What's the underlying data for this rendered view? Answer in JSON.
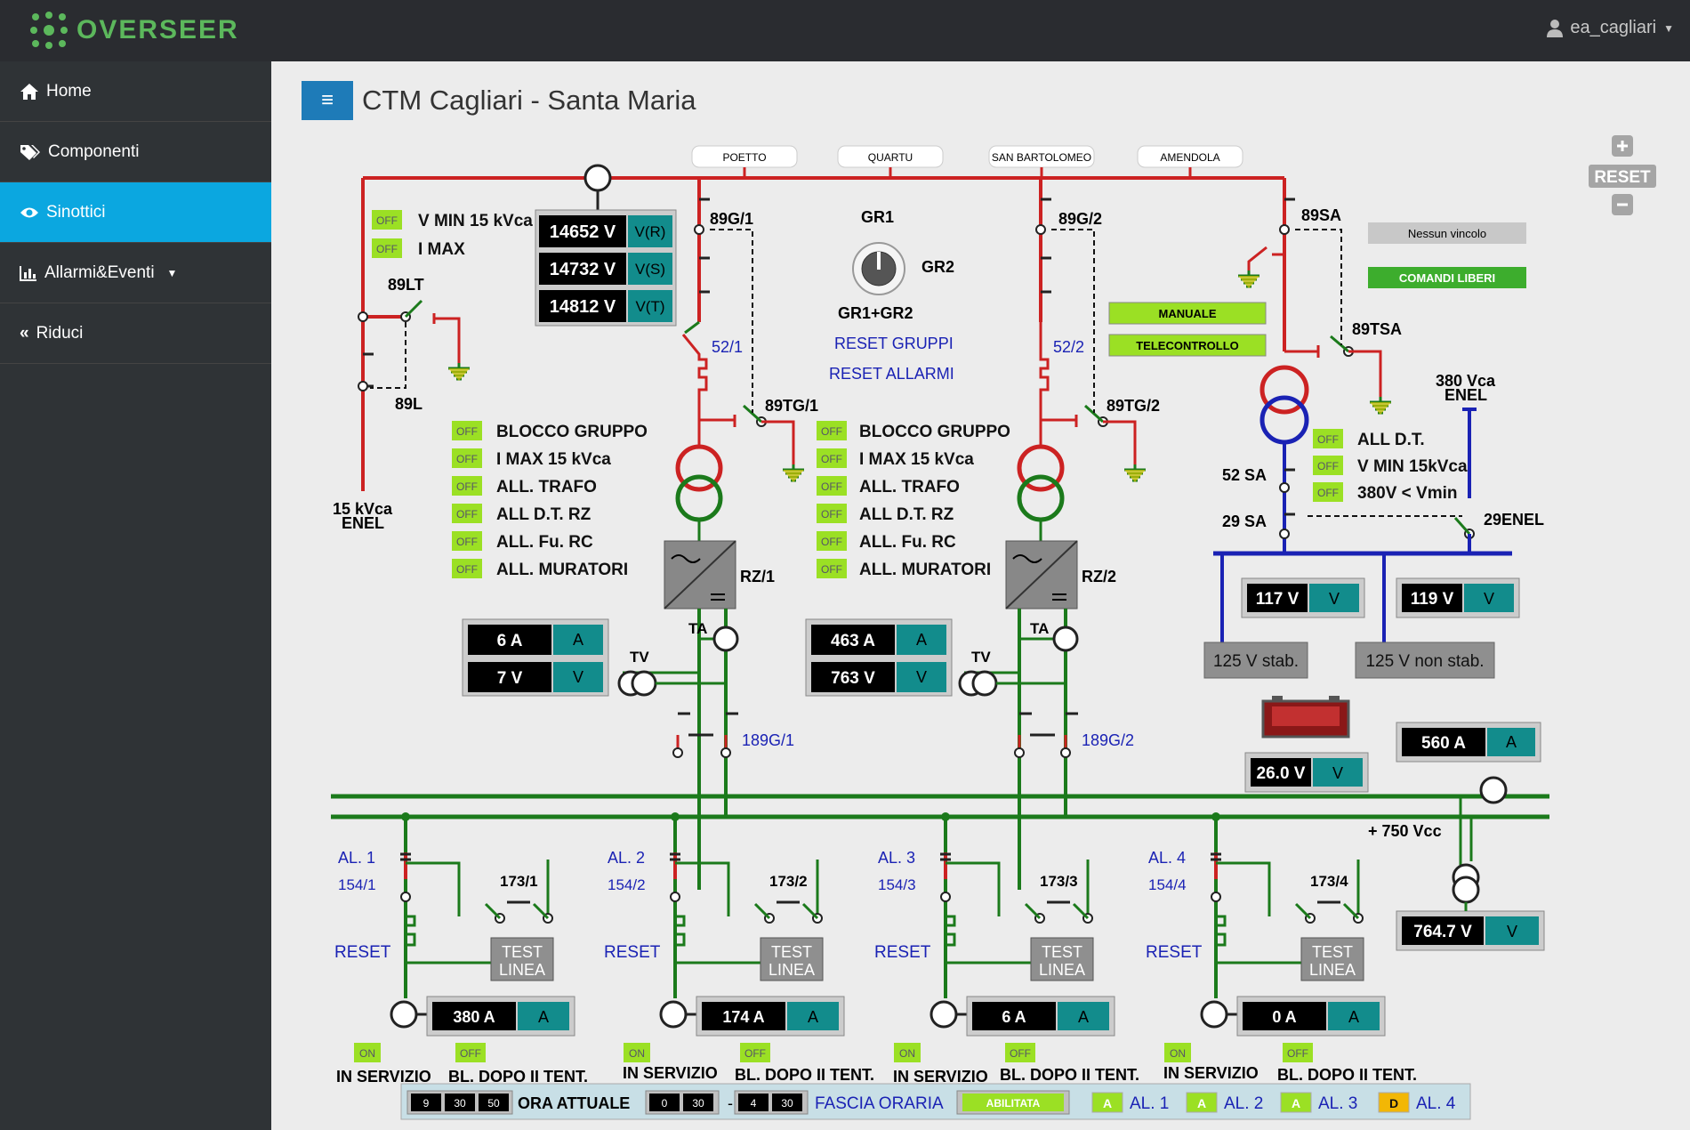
{
  "app": {
    "name": "OVERSEER",
    "user": "ea_cagliari"
  },
  "sidebar": {
    "items": [
      {
        "label": "Home",
        "icon": "home-icon"
      },
      {
        "label": "Componenti",
        "icon": "tags-icon"
      },
      {
        "label": "Sinottici",
        "icon": "eye-icon",
        "active": true
      },
      {
        "label": "Allarmi&Eventi",
        "icon": "bar-chart-icon"
      },
      {
        "label": "Riduci",
        "icon": "double-chevron-left-icon"
      }
    ]
  },
  "page": {
    "title": "CTM Cagliari - Santa Maria"
  },
  "zoom": {
    "plus": "+",
    "reset": "RESET",
    "minus": "−"
  },
  "feeders": [
    "POETTO",
    "QUARTU",
    "SAN BARTOLOMEO",
    "AMENDOLA"
  ],
  "labels": {
    "v_min_15": "V MIN 15 kVca",
    "i_max": "I MAX",
    "lt89": "89LT",
    "l89": "89L",
    "enel15a": "15 kVca",
    "enel15b": "ENEL",
    "g1": "89G/1",
    "g2": "89G/2",
    "sa89": "89SA",
    "tsa89": "89TSA",
    "s521": "52/1",
    "s522": "52/2",
    "tg1": "89TG/1",
    "tg2": "89TG/2",
    "gr1": "GR1",
    "gr2": "GR2",
    "gr12": "GR1+GR2",
    "reset_gruppi": "RESET GRUPPI",
    "reset_allarmi": "RESET ALLARMI",
    "nessun_vincolo": "Nessun vincolo",
    "comandi_liberi": "COMANDI LIBERI",
    "manuale": "MANUALE",
    "telecontrollo": "TELECONTROLLO",
    "enel380a": "380 Vca",
    "enel380b": "ENEL",
    "sa52": "52 SA",
    "sa29": "29 SA",
    "enel29": "29ENEL",
    "rz1": "RZ/1",
    "rz2": "RZ/2",
    "ta": "TA",
    "tv": "TV",
    "g1891": "189G/1",
    "g1892": "189G/2",
    "stab": "125 V stab.",
    "nonstab": "125 V non stab.",
    "vcc750": "+ 750 Vcc",
    "off": "OFF",
    "on": "ON"
  },
  "voltages_main": [
    {
      "value": "14652 V",
      "unit": "V(R)"
    },
    {
      "value": "14732 V",
      "unit": "V(S)"
    },
    {
      "value": "14812 V",
      "unit": "V(T)"
    }
  ],
  "alarms_group": [
    "BLOCCO GRUPPO",
    "I MAX 15 kVca",
    "ALL. TRAFO",
    "ALL D.T. RZ",
    "ALL. Fu. RC",
    "ALL. MURATORI"
  ],
  "alarms_sa": [
    "ALL D.T.",
    "V MIN 15kVca",
    "380V < Vmin"
  ],
  "group1_meters": [
    {
      "value": "6 A",
      "unit": "A"
    },
    {
      "value": "7 V",
      "unit": "V"
    }
  ],
  "group2_meters": [
    {
      "value": "463 A",
      "unit": "A"
    },
    {
      "value": "763 V",
      "unit": "V"
    }
  ],
  "aux_meters": {
    "v117": {
      "value": "117 V",
      "unit": "V"
    },
    "v119": {
      "value": "119 V",
      "unit": "V"
    },
    "v26": {
      "value": "26.0 V",
      "unit": "V"
    },
    "a560": {
      "value": "560 A",
      "unit": "A"
    },
    "v764": {
      "value": "764.7 V",
      "unit": "V"
    }
  },
  "lines": [
    {
      "al": "AL. 1",
      "code": "154/1",
      "disc": "173/1",
      "reset": "RESET",
      "test1": "TEST",
      "test2": "LINEA",
      "current": "380 A",
      "unit": "A",
      "in_servizio": "IN SERVIZIO",
      "bl": "BL. DOPO II TENT."
    },
    {
      "al": "AL. 2",
      "code": "154/2",
      "disc": "173/2",
      "reset": "RESET",
      "test1": "TEST",
      "test2": "LINEA",
      "current": "174 A",
      "unit": "A",
      "in_servizio": "IN SERVIZIO",
      "bl": "BL. DOPO II TENT."
    },
    {
      "al": "AL. 3",
      "code": "154/3",
      "disc": "173/3",
      "reset": "RESET",
      "test1": "TEST",
      "test2": "LINEA",
      "current": "6 A",
      "unit": "A",
      "in_servizio": "IN SERVIZIO",
      "bl": "BL. DOPO II TENT."
    },
    {
      "al": "AL. 4",
      "code": "154/4",
      "disc": "173/4",
      "reset": "RESET",
      "test1": "TEST",
      "test2": "LINEA",
      "current": "0 A",
      "unit": "A",
      "in_servizio": "IN SERVIZIO",
      "bl": "BL. DOPO II TENT."
    }
  ],
  "bottom": {
    "time": [
      "9",
      "30",
      "50"
    ],
    "ora_attuale": "ORA ATTUALE",
    "fascia_from": [
      "0",
      "30"
    ],
    "dash": "-",
    "fascia_to": [
      "4",
      "30"
    ],
    "fascia_oraria": "FASCIA ORARIA",
    "abilitata": "ABILITATA",
    "al_badges": [
      {
        "badge": "A",
        "label": "AL. 1",
        "color": "#9be024"
      },
      {
        "badge": "A",
        "label": "AL. 2",
        "color": "#9be024"
      },
      {
        "badge": "A",
        "label": "AL. 3",
        "color": "#9be024"
      },
      {
        "badge": "D",
        "label": "AL. 4",
        "color": "#f2b705"
      }
    ]
  },
  "colors": {
    "green_line": "#1b7a1b",
    "red_line": "#cc2222",
    "blue_line": "#1a22b4",
    "accent": "#0ba7e0",
    "teal_unit": "#128c8c",
    "status_green": "#9be024"
  }
}
